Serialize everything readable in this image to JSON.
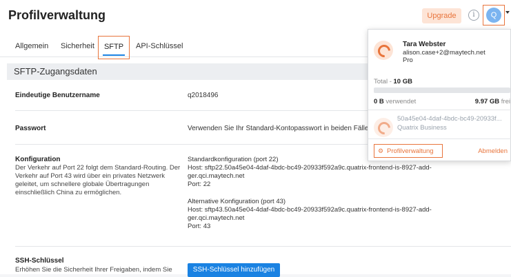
{
  "header": {
    "title": "Profilverwaltung",
    "upgrade_label": "Upgrade",
    "info_icon": "info-icon",
    "avatar_initial": "Q"
  },
  "tabs": [
    {
      "label": "Allgemein"
    },
    {
      "label": "Sicherheit"
    },
    {
      "label": "SFTP",
      "active": true
    },
    {
      "label": "API-Schlüssel"
    }
  ],
  "sftp": {
    "section_title": "SFTP-Zugangsdaten",
    "username_label": "Eindeutige Benutzername",
    "username_value": "q2018496",
    "password_label": "Passwort",
    "password_value": "Verwenden Sie Ihr Standard-Kontopasswort in beiden Fälle",
    "config_label": "Konfiguration",
    "config_desc": "Der Verkehr auf Port 22 folgt dem Standard-Routing. Der Verkehr auf Port 43 wird über ein privates Netzwerk geleitet, um schnellere globale Übertragungen einschließlich China zu ermöglichen.",
    "std_title": "Standardkonfiguration (port 22)",
    "std_host_1": "Host: sftp22.50a45e04-4daf-4bdc-bc49-20933f592a9c.quatrix-frontend-is-8927-add-",
    "std_host_2": "ger.qci.maytech.net",
    "std_port": "Port: 22",
    "alt_title": "Alternative Konfiguration (port 43)",
    "alt_host_1": "Host: sftp43.50a45e04-4daf-4bdc-bc49-20933f592a9c.quatrix-frontend-is-8927-add-",
    "alt_host_2": "ger.qci.maytech.net",
    "alt_port": "Port: 43",
    "ssh_label": "SSH-Schlüssel",
    "ssh_desc": "Erhöhen Sie die Sicherheit Ihrer Freigaben, indem Sie",
    "ssh_button": "SSH-Schlüssel hinzufügen"
  },
  "dropdown": {
    "name": "Tara Webster",
    "email": "alison.case+2@maytech.net",
    "plan": "Pro",
    "total_prefix": "Total - ",
    "total_value": "10 GB",
    "used_value": "0 B",
    "used_suffix": " verwendet",
    "free_value": "9.97 GB",
    "free_suffix": " frei",
    "usage_fraction": 0.0,
    "workspace_id": "50a45e04-4daf-4bdc-bc49-20933f...",
    "workspace_name": "Quatrix Business",
    "profile_label": "Profilverwaltung",
    "logout_label": "Abmelden"
  },
  "colors": {
    "accent": "#e8743b",
    "primary": "#1a82e2"
  }
}
